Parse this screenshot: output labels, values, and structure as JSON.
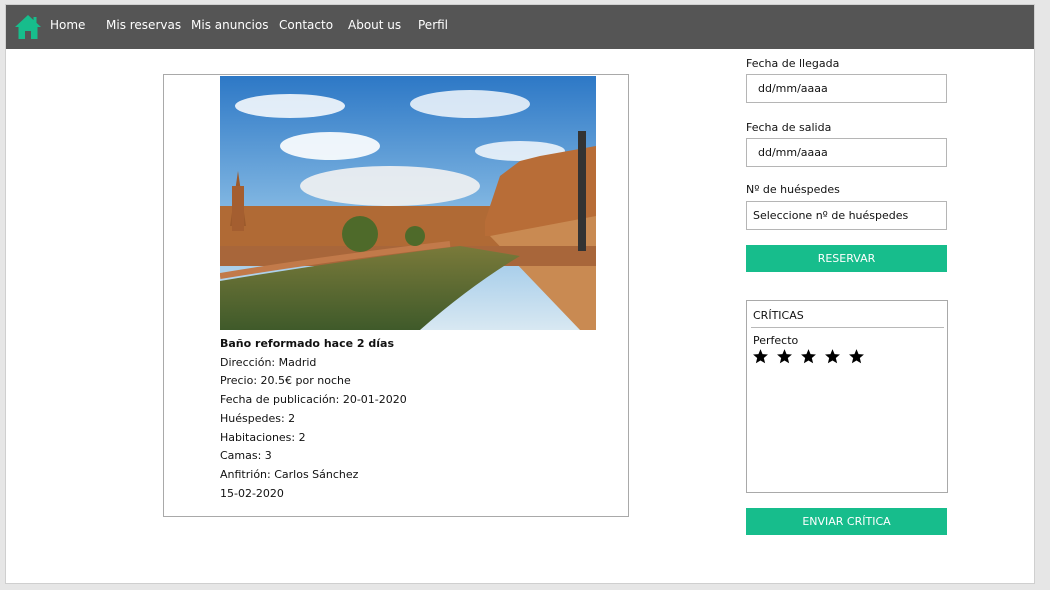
{
  "nav": {
    "home_icon": "house-icon",
    "brand_color": "#17bd8c",
    "items": [
      {
        "label": "Home"
      },
      {
        "label": "Mis reservas"
      },
      {
        "label": "Mis anuncios"
      },
      {
        "label": "Contacto"
      },
      {
        "label": "About us"
      },
      {
        "label": "Perfil"
      }
    ]
  },
  "listing": {
    "title": "Baño reformado hace 2 días",
    "address": "Dirección: Madrid",
    "price": "Precio: 20.5€ por noche",
    "published": "Fecha de publicación: 20-01-2020",
    "guests": "Huéspedes: 2",
    "rooms": "Habitaciones: 2",
    "beds": "Camas: 3",
    "host": "Anfitrión: Carlos Sánchez",
    "date": "15-02-2020"
  },
  "booking": {
    "arrival_label": "Fecha de llegada",
    "arrival_placeholder": "dd/mm/aaaa",
    "departure_label": "Fecha de salida",
    "departure_placeholder": "dd/mm/aaaa",
    "guests_label": "Nº de huéspedes",
    "guests_select": "Seleccione nº de huéspedes",
    "reserve_button": "RESERVAR"
  },
  "reviews": {
    "title": "CRÍTICAS",
    "items": [
      {
        "text": "Perfecto",
        "stars": 5
      }
    ],
    "send_button": "ENVIAR CRÍTICA"
  },
  "colors": {
    "navbar": "#555555",
    "accent": "#17bd8c"
  }
}
